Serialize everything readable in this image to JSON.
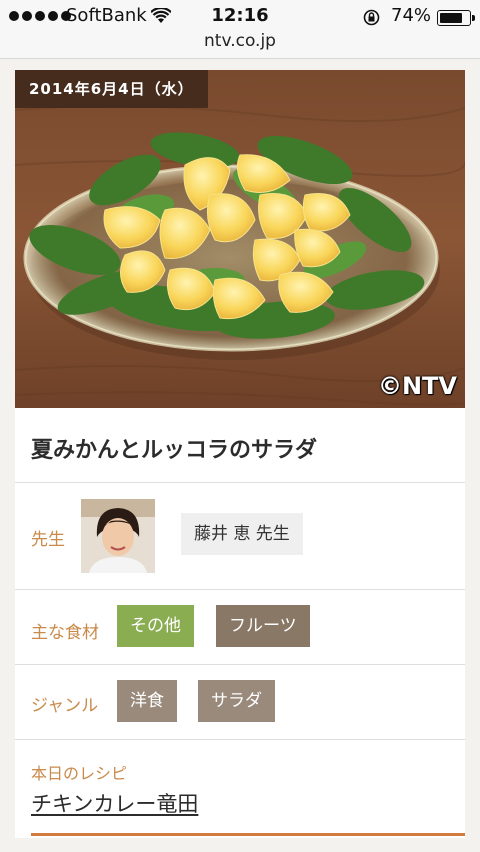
{
  "status_bar": {
    "carrier": "SoftBank",
    "time": "12:16",
    "battery": "74%",
    "battery_level": 0.74
  },
  "browser": {
    "url": "ntv.co.jp"
  },
  "article": {
    "date": "2014年6月4日（水）",
    "watermark": "©NTV",
    "title": "夏みかんとルッコラのサラダ",
    "teacher": {
      "label": "先生",
      "name": "藤井 恵 先生"
    },
    "ingredients": {
      "label": "主な食材",
      "tags": [
        "その他",
        "フルーツ"
      ]
    },
    "genre": {
      "label": "ジャンル",
      "tags": [
        "洋食",
        "サラダ"
      ]
    },
    "todays_recipe": {
      "label": "本日のレシピ",
      "link": "チキンカレー竜田"
    }
  },
  "colors": {
    "accent_label": "#c98a4a",
    "tag_green": "#8aad52",
    "tag_brown": "#8a7866",
    "rule_orange": "#d37a3c"
  }
}
